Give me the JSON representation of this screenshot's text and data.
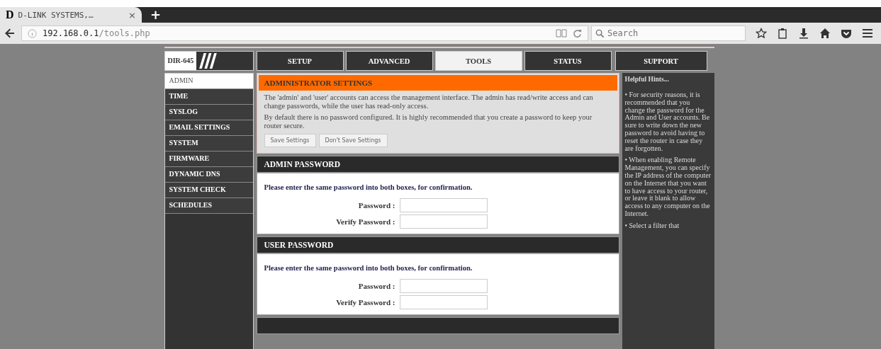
{
  "browser": {
    "tab": {
      "favicon": "D",
      "title": "D-LINK SYSTEMS,…",
      "close": "×"
    },
    "new_tab": "+",
    "url_host": "192.168.0.1",
    "url_path": "/tools.php",
    "search": {
      "placeholder": "Search"
    }
  },
  "router": {
    "model": "DIR-645",
    "tabs": [
      {
        "label": "SETUP",
        "selected": false
      },
      {
        "label": "ADVANCED",
        "selected": false
      },
      {
        "label": "TOOLS",
        "selected": true
      },
      {
        "label": "STATUS",
        "selected": false
      },
      {
        "label": "SUPPORT",
        "selected": false
      }
    ],
    "sidebar": [
      {
        "label": "ADMIN",
        "selected": true
      },
      {
        "label": "TIME",
        "selected": false
      },
      {
        "label": "SYSLOG",
        "selected": false
      },
      {
        "label": "EMAIL SETTINGS",
        "selected": false
      },
      {
        "label": "SYSTEM",
        "selected": false
      },
      {
        "label": "FIRMWARE",
        "selected": false
      },
      {
        "label": "DYNAMIC DNS",
        "selected": false
      },
      {
        "label": "SYSTEM CHECK",
        "selected": false
      },
      {
        "label": "SCHEDULES",
        "selected": false
      }
    ],
    "settings": {
      "title": "ADMINISTRATOR SETTINGS",
      "paragraphs": [
        "The 'admin' and 'user' accounts can access the management interface. The admin has read/write access and can change passwords, while the user has read-only access.",
        "By default there is no password configured. It is highly recommended that you create a password to keep your router secure."
      ],
      "buttons": [
        "Save Settings",
        "Don't Save Settings"
      ]
    },
    "sections": [
      {
        "title": "ADMIN PASSWORD",
        "instruction": "Please enter the same password into both boxes, for confirmation.",
        "fields": [
          {
            "label": "Password :"
          },
          {
            "label": "Verify Password :"
          }
        ]
      },
      {
        "title": "USER PASSWORD",
        "instruction": "Please enter the same password into both boxes, for confirmation.",
        "fields": [
          {
            "label": "Password :"
          },
          {
            "label": "Verify Password :"
          }
        ]
      }
    ],
    "hints": {
      "title": "Helpful Hints...",
      "items": [
        "• For security reasons, it is recommended that you change the password for the Admin and User accounts. Be sure to write down the new password to avoid having to reset the router in case they are forgotten.",
        "• When enabling Remote Management, you can specify the IP address of the computer on the Internet that you want to have access to your router, or leave it blank to allow access to any computer on the Internet.",
        "• Select a filter that"
      ]
    }
  }
}
